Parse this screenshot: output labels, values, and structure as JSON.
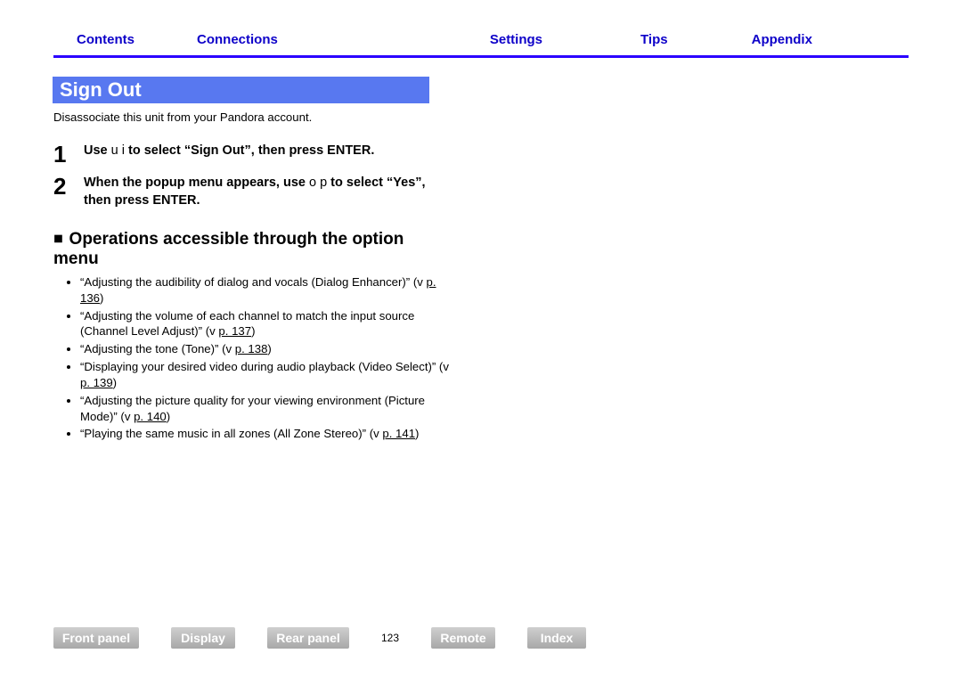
{
  "topnav": {
    "contents": "Contents",
    "connections": "Connections",
    "settings": "Settings",
    "tips": "Tips",
    "appendix": "Appendix"
  },
  "heading": "Sign Out",
  "intro": "Disassociate this unit from your Pandora account.",
  "steps": {
    "s1": {
      "num": "1",
      "pre": "Use ",
      "glyph": "u i",
      "post": " to select “Sign Out”, then press ENTER."
    },
    "s2": {
      "num": "2",
      "pre": "When the popup menu appears, use ",
      "glyph": "o p",
      "post": " to select “Yes”, then press ENTER."
    }
  },
  "ops_heading": "Operations accessible through the option menu",
  "ops": {
    "i1": {
      "text": "“Adjusting the audibility of dialog and vocals (Dialog Enhancer)” (v",
      "pref": "p. 136",
      "tail": ")"
    },
    "i2": {
      "text": "“Adjusting the volume of each channel to match the input source (Channel Level Adjust)” (v",
      "pref": "p. 137",
      "tail": ")"
    },
    "i3": {
      "text": "“Adjusting the tone (Tone)” (v",
      "pref": "p. 138",
      "tail": ")"
    },
    "i4": {
      "text": "“Displaying your desired video during audio playback (Video Select)” (v",
      "pref": "p. 139",
      "tail": ")"
    },
    "i5": {
      "text": "“Adjusting the picture quality for your viewing environment (Picture Mode)” (v",
      "pref": "p. 140",
      "tail": ")"
    },
    "i6": {
      "text": "“Playing the same music in all zones (All Zone Stereo)” (v",
      "pref": "p. 141",
      "tail": ")"
    }
  },
  "bottomnav": {
    "front": "Front panel",
    "display": "Display",
    "rear": "Rear panel",
    "remote": "Remote",
    "index": "Index"
  },
  "page": "123"
}
